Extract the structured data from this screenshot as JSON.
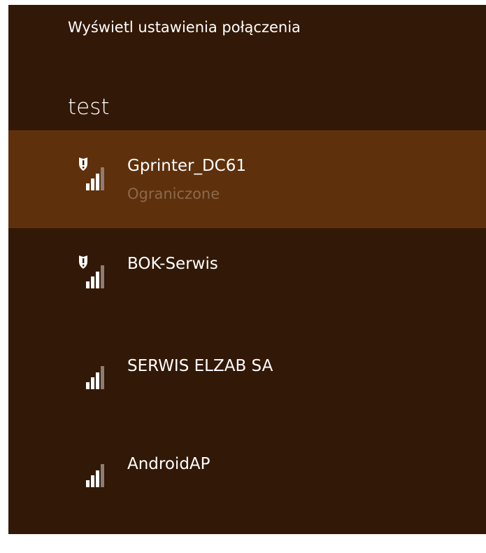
{
  "panel": {
    "settings_link": "Wyświetl ustawienia połączenia",
    "group_title": "test"
  },
  "networks": [
    {
      "name": "Gprinter_DC61",
      "status": "Ograniczone",
      "secured": true,
      "signal_bars": 3,
      "selected": true
    },
    {
      "name": "BOK-Serwis",
      "status": "",
      "secured": true,
      "signal_bars": 3,
      "selected": false
    },
    {
      "name": "SERWIS ELZAB SA",
      "status": "",
      "secured": false,
      "signal_bars": 3,
      "selected": false
    },
    {
      "name": "AndroidAP",
      "status": "",
      "secured": false,
      "signal_bars": 3,
      "selected": false
    }
  ],
  "colors": {
    "panel_bg": "#321806",
    "selected_bg": "#5e300c",
    "status_text": "#8c6a4c"
  },
  "icons": {
    "signal": "wifi-signal-icon",
    "shield": "security-shield-icon"
  }
}
